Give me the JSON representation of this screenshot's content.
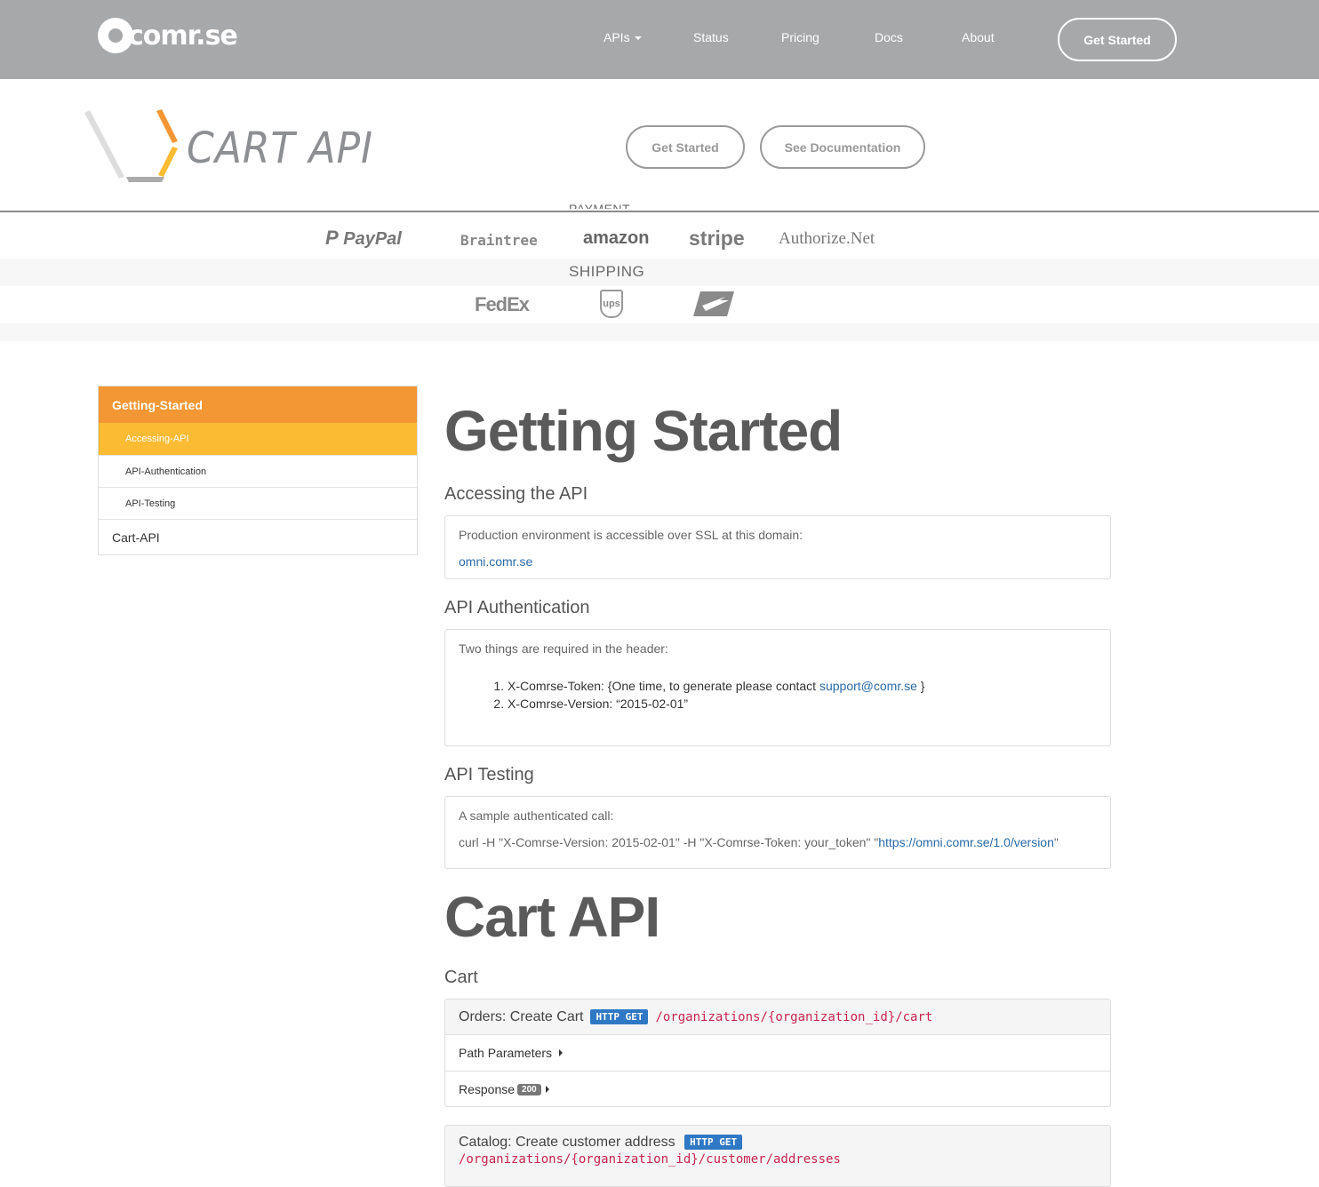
{
  "nav": {
    "logo_text": "comr.se",
    "items": [
      {
        "label": "APIs"
      },
      {
        "label": "Status"
      },
      {
        "label": "Pricing"
      },
      {
        "label": "Docs"
      },
      {
        "label": "About"
      }
    ],
    "cta_label": "Get Started"
  },
  "hero": {
    "title": "CART API",
    "get_started_label": "Get Started",
    "docs_label": "See Documentation"
  },
  "partners": {
    "payment_label": "PAYMENT",
    "payment": [
      "PayPal",
      "Braintree",
      "amazon",
      "stripe",
      "Authorize.Net"
    ],
    "shipping_label": "SHIPPING",
    "shipping": [
      "FedEx",
      "ups",
      "usps-eagle-icon"
    ]
  },
  "sidebar": {
    "section": "Getting-Started",
    "items": [
      "Accessing-API",
      "API-Authentication",
      "API-Testing"
    ],
    "cart": "Cart-API"
  },
  "content": {
    "h1_getting_started": "Getting Started",
    "accessing_title": "Accessing the API",
    "accessing_text": "Production environment is accessible over SSL at this domain:",
    "accessing_link": "omni.comr.se",
    "auth_title": "API Authentication",
    "auth_text": "Two things are required in the header:",
    "auth_item1_prefix": "X-Comrse-Token: {One time, to generate please contact ",
    "auth_item1_link": "support@comr.se",
    "auth_item1_suffix": " }",
    "auth_item2": "X-Comrse-Version: “2015-02-01”",
    "testing_title": "API Testing",
    "testing_text": "A sample authenticated call:",
    "testing_cmd": "curl -H \"X-Comrse-Version: 2015-02-01\" -H \"X-Comrse-Token: your_token\" \"",
    "testing_url": "https://omni.comr.se/1.0/version",
    "testing_end": "\"",
    "h1_cart": "Cart API",
    "cart_title": "Cart",
    "endpoint1": {
      "name": "Orders: Create Cart",
      "method": "HTTP GET",
      "path": "/organizations/{organization_id}/cart",
      "path_params": "Path Parameters",
      "response": "Response",
      "status": "200"
    },
    "endpoint2": {
      "name": "Catalog: Create customer address",
      "method": "HTTP GET",
      "path": "/organizations/{organization_id}/customer/addresses"
    }
  },
  "colors": {
    "nav_bg": "#a7a8aa",
    "sidebar_header": "#f39734",
    "sidebar_active": "#fbbb33",
    "badge_blue": "#2f78c4",
    "code_red": "#c7254e"
  }
}
